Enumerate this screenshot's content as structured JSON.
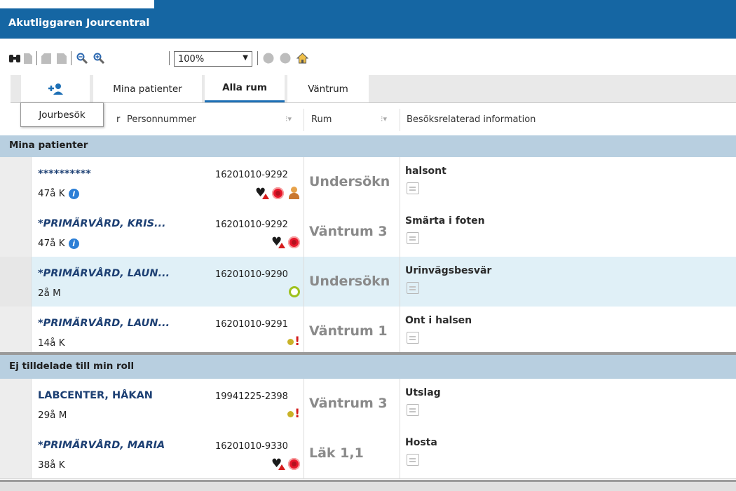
{
  "app": {
    "title": "Akutliggaren Jourcentral"
  },
  "toolbar": {
    "icons": [
      "binoculars-icon",
      "page-icon",
      "prev-page-icon",
      "next-page-icon",
      "zoom-out-icon",
      "zoom-in-icon",
      "circle-icon",
      "circle-icon",
      "home-icon"
    ],
    "zoom": "100%"
  },
  "tabs": {
    "add_tooltip": "Jourbesök",
    "items": [
      "Mina patienter",
      "Alla rum",
      "Väntrum"
    ],
    "active": "Alla rum"
  },
  "columns": {
    "personnummer": "Personnummer",
    "personnummer_prefix": "r",
    "rum": "Rum",
    "info": "Besöksrelaterad information"
  },
  "groups": {
    "mine": "Mina patienter",
    "unassigned": "Ej tilldelade till min roll"
  },
  "patients": [
    {
      "name": "**********",
      "age": "47å K",
      "info_badge": true,
      "pnr": "16201010-9292",
      "icons": [
        "heart-warning-icon",
        "infection-icon",
        "person-icon"
      ],
      "room": "Undersökn",
      "info": "halsont"
    },
    {
      "name": "*PRIMÄRVÅRD, KRIS...",
      "age": "47å K",
      "info_badge": true,
      "pnr": "16201010-9292",
      "icons": [
        "heart-warning-icon",
        "infection-icon"
      ],
      "room": "Väntrum 3",
      "info": "Smärta i foten"
    },
    {
      "name": "*PRIMÄRVÅRD, LAUN...",
      "age": "2å M",
      "info_badge": false,
      "pnr": "16201010-9290",
      "icons": [
        "status-ring-icon"
      ],
      "room": "Undersökn",
      "info": "Urinvägsbesvär",
      "selected": true
    },
    {
      "name": "*PRIMÄRVÅRD, LAUN...",
      "age": "14å K",
      "info_badge": false,
      "pnr": "16201010-9291",
      "icons": [
        "alert-icon"
      ],
      "room": "Väntrum 1",
      "info": "Ont i halsen"
    },
    {
      "name": "LABCENTER, HÅKAN",
      "age": "29å M",
      "info_badge": false,
      "pnr": "19941225-2398",
      "icons": [
        "alert-icon"
      ],
      "room": "Väntrum 3",
      "info": "Utslag",
      "plain": true
    },
    {
      "name": "*PRIMÄRVÅRD, MARIA",
      "age": "38å K",
      "info_badge": false,
      "pnr": "16201010-9330",
      "icons": [
        "heart-warning-icon",
        "infection-icon"
      ],
      "room": "Läk 1,1",
      "info": "Hosta"
    }
  ]
}
